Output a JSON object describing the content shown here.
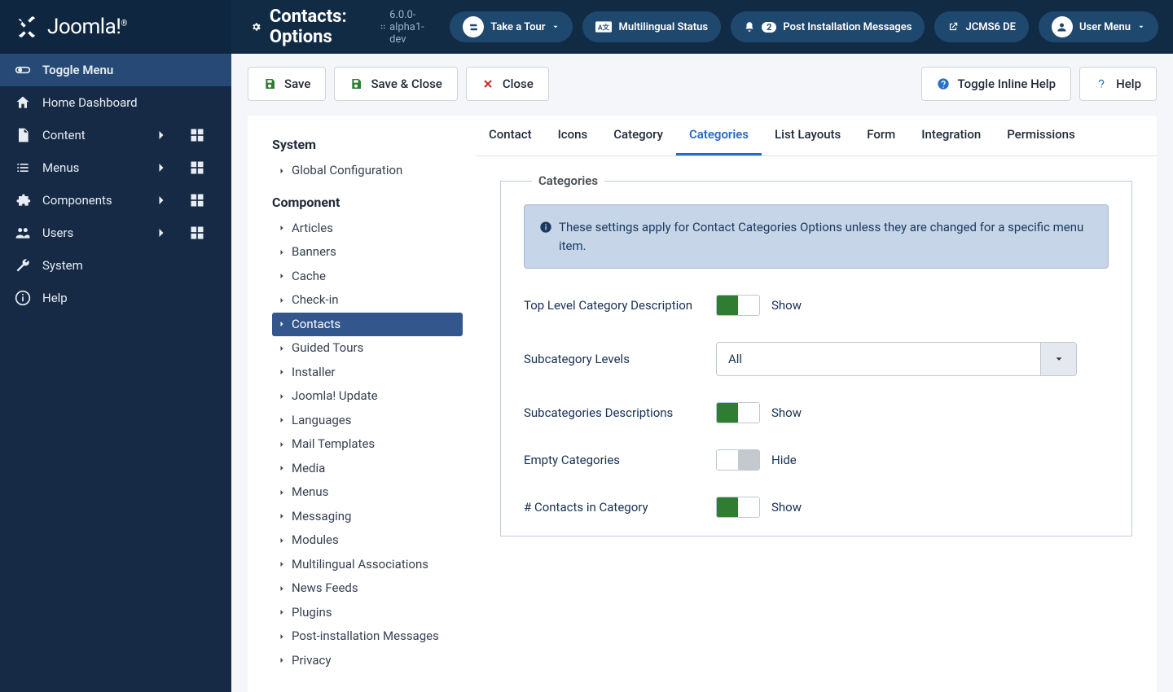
{
  "brand": "Joomla!",
  "page_title": "Contacts: Options",
  "version": "6.0.0-alpha1-dev",
  "header_pills": {
    "tour": "Take a Tour",
    "multilingual": "Multilingual Status",
    "post_install": "Post Installation Messages",
    "post_install_count": "2",
    "site_name": "JCMS6 DE",
    "user_menu": "User Menu"
  },
  "sidebar": {
    "toggle": "Toggle Menu",
    "items": [
      {
        "label": "Home Dashboard"
      },
      {
        "label": "Content"
      },
      {
        "label": "Menus"
      },
      {
        "label": "Components"
      },
      {
        "label": "Users"
      },
      {
        "label": "System"
      },
      {
        "label": "Help"
      }
    ]
  },
  "toolbar": {
    "save": "Save",
    "save_close": "Save & Close",
    "close": "Close",
    "toggle_help": "Toggle Inline Help",
    "help": "Help"
  },
  "left_panel": {
    "system_head": "System",
    "global_config": "Global Configuration",
    "component_head": "Component",
    "items": [
      "Articles",
      "Banners",
      "Cache",
      "Check-in",
      "Contacts",
      "Guided Tours",
      "Installer",
      "Joomla! Update",
      "Languages",
      "Mail Templates",
      "Media",
      "Menus",
      "Messaging",
      "Modules",
      "Multilingual Associations",
      "News Feeds",
      "Plugins",
      "Post-installation Messages",
      "Privacy"
    ]
  },
  "tabs": [
    "Contact",
    "Icons",
    "Category",
    "Categories",
    "List Layouts",
    "Form",
    "Integration",
    "Permissions"
  ],
  "active_tab": "Categories",
  "fieldset": {
    "legend": "Categories",
    "alert": "These settings apply for Contact Categories Options unless they are changed for a specific menu item.",
    "rows": [
      {
        "label": "Top Level Category Description",
        "type": "toggle",
        "value": "Show",
        "on": true
      },
      {
        "label": "Subcategory Levels",
        "type": "select",
        "value": "All"
      },
      {
        "label": "Subcategories Descriptions",
        "type": "toggle",
        "value": "Show",
        "on": true
      },
      {
        "label": "Empty Categories",
        "type": "toggle",
        "value": "Hide",
        "on": false
      },
      {
        "label": "# Contacts in Category",
        "type": "toggle",
        "value": "Show",
        "on": true
      }
    ]
  }
}
